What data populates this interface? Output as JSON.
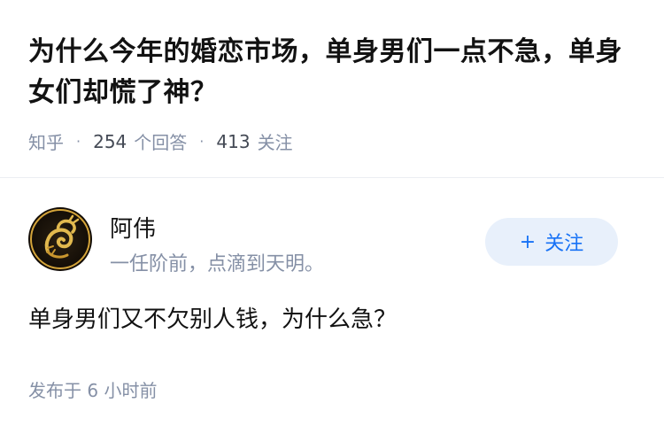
{
  "question": {
    "title": "为什么今年的婚恋市场，单身男们一点不急，单身女们却慌了神？",
    "source": "知乎",
    "answer_count": "254",
    "answer_label": "个回答",
    "follow_count": "413",
    "follow_label": "关注"
  },
  "author": {
    "name": "阿伟",
    "bio": "一任阶前，点滴到天明。",
    "avatar_icon": "golden-dragon-emblem",
    "follow_plus": "+",
    "follow_label": "关注"
  },
  "answer": {
    "content": "单身男们又不欠别人钱，为什么急？",
    "published": "发布于 6 小时前"
  },
  "colors": {
    "accent": "#1772f6",
    "follow_bg": "#e8f0fb",
    "meta_gray": "#8590a6"
  }
}
